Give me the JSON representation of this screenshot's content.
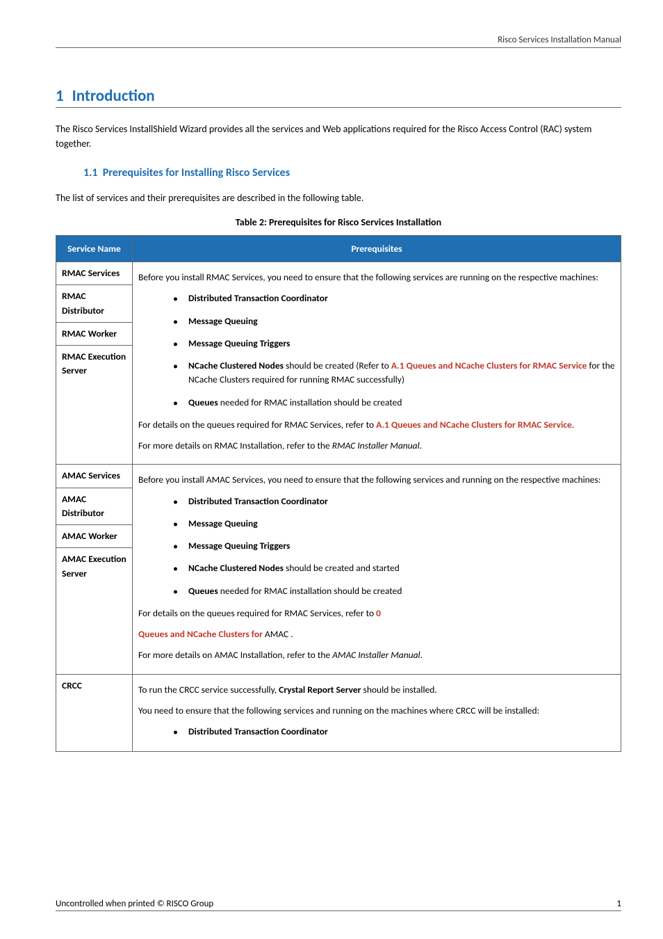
{
  "header": {
    "doc_title": "Risco Services Installation Manual"
  },
  "section": {
    "num": "1",
    "title": "Introduction"
  },
  "intro": "The Risco Services InstallShield Wizard provides all the services and Web applications required for the Risco Access Control (RAC) system together.",
  "subsection": {
    "num": "1.1",
    "title": "Prerequisites for Installing Risco Services"
  },
  "subsection_intro": "The list of services and their prerequisites are described in the following table.",
  "table_caption": "Table 2: Prerequisites for Risco Services Installation",
  "th": {
    "service": "Service Name",
    "prereq": "Prerequisites"
  },
  "rmac": {
    "names": [
      "RMAC Services",
      "RMAC Distributor",
      "RMAC Worker",
      "RMAC Execution Server"
    ],
    "lead": "Before you install RMAC Services, you need to ensure that the following services are running on the respective machines:",
    "b1": "Distributed Transaction Coordinator",
    "b2": "Message Queuing",
    "b3": "Message Queuing Triggers",
    "b4a": "NCache Clustered Nodes",
    "b4b": " should be created (Refer to ",
    "b4ref": "A.1 Queues and NCache Clusters for RMAC Service",
    "b4c": " for the NCache Clusters required for running RMAC successfully)",
    "b5a": "Queues",
    "b5b": " needed for RMAC installation should be created",
    "ref1a": "For details on the queues required for RMAC Services, refer to ",
    "ref1b": "A.1 Queues and NCache Clusters for RMAC Service",
    "ref1c": ".",
    "ref2a": "For more details on RMAC Installation, refer to the ",
    "ref2b": "RMAC Installer Manual",
    "ref2c": "."
  },
  "amac": {
    "names": [
      "AMAC Services",
      "AMAC Distributor",
      "AMAC Worker",
      "AMAC Execution Server"
    ],
    "lead": "Before you install AMAC Services, you need to ensure that the following services and running on the respective machines:",
    "b1": "Distributed Transaction Coordinator",
    "b2": "Message Queuing",
    "b3": "Message Queuing Triggers",
    "b4a": "NCache Clustered Nodes",
    "b4b": " should be created and started",
    "b5a": "Queues",
    "b5b": " needed for RMAC installation should be created",
    "ref1a": "For details on the queues required for RMAC Services, refer to ",
    "ref1b": "0",
    "ref2a": "Queues and NCache Clusters for ",
    "ref2b": "AMAC .",
    "ref3a": "For more details on AMAC Installation, refer to the ",
    "ref3b": "AMAC Installer Manual",
    "ref3c": "."
  },
  "crcc": {
    "name": "CRCC",
    "p1a": "To run the CRCC service successfully, ",
    "p1b": "Crystal Report Server",
    "p1c": " should be installed.",
    "p2": "You need to ensure that the following services and running on the machines where CRCC will be installed:",
    "b1": "Distributed Transaction Coordinator"
  },
  "footer": {
    "left": "Uncontrolled when printed © RISCO Group",
    "right": "1"
  }
}
